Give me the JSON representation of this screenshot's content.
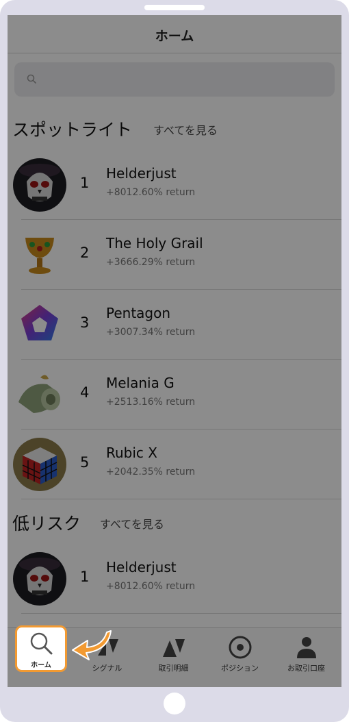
{
  "header": {
    "title": "ホーム"
  },
  "search": {
    "placeholder": ""
  },
  "sections": {
    "spotlight": {
      "title": "スポットライト",
      "see_all": "すべてを見る"
    },
    "low_risk": {
      "title": "低リスク",
      "see_all": "すべてを見る"
    }
  },
  "spotlight_items": [
    {
      "rank": "1",
      "name": "Helderjust",
      "return": "+8012.60% return",
      "avatar": "skull-icon"
    },
    {
      "rank": "2",
      "name": "The Holy Grail",
      "return": "+3666.29% return",
      "avatar": "grail-icon"
    },
    {
      "rank": "3",
      "name": "Pentagon",
      "return": "+3007.34% return",
      "avatar": "pentagon-logo-icon"
    },
    {
      "rank": "4",
      "name": "Melania G",
      "return": "+2513.16% return",
      "avatar": "money-roll-icon"
    },
    {
      "rank": "5",
      "name": "Rubic X",
      "return": "+2042.35% return",
      "avatar": "rubiks-cube-icon"
    }
  ],
  "low_risk_items": [
    {
      "rank": "1",
      "name": "Helderjust",
      "return": "+8012.60% return",
      "avatar": "skull-icon"
    }
  ],
  "tabs": [
    {
      "label": "ホーム",
      "icon": "search-icon",
      "active": true
    },
    {
      "label": "シグナル",
      "icon": "signal-icon",
      "active": false
    },
    {
      "label": "取引明細",
      "icon": "trade-history-icon",
      "active": false
    },
    {
      "label": "ポジション",
      "icon": "position-icon",
      "active": false
    },
    {
      "label": "お取引口座",
      "icon": "account-icon",
      "active": false
    }
  ],
  "colors": {
    "highlight": "#f29a32",
    "overlay": "rgba(0,0,0,0.45)"
  }
}
